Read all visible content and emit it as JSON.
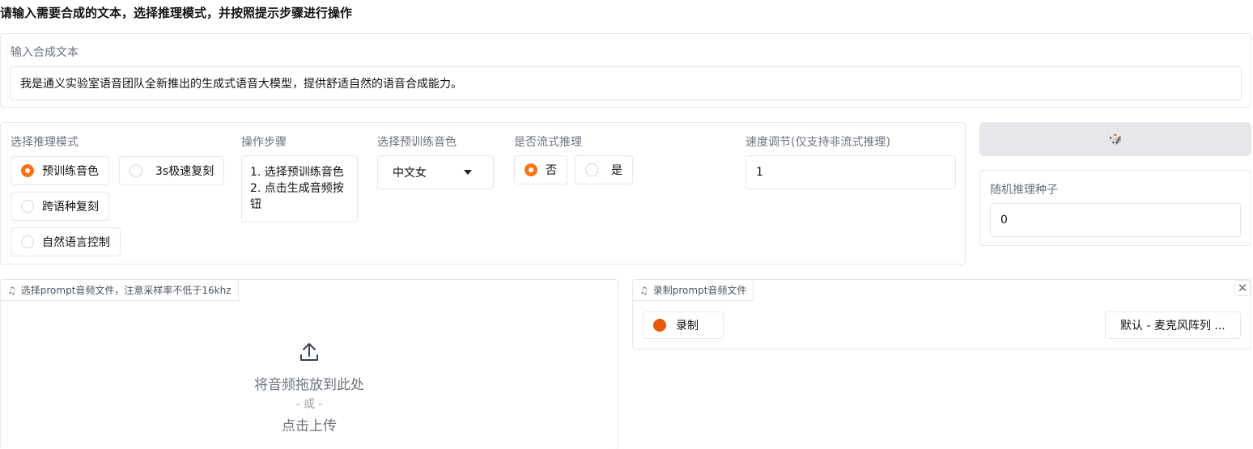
{
  "heading": "请输入需要合成的文本，选择推理模式，并按照提示步骤进行操作",
  "text_input": {
    "label": "输入合成文本",
    "value": "我是通义实验室语音团队全新推出的生成式语音大模型，提供舒适自然的语音合成能力。"
  },
  "mode": {
    "label": "选择推理模式",
    "options": [
      {
        "label": "预训练音色",
        "selected": true
      },
      {
        "label": "3s极速复刻",
        "selected": false
      },
      {
        "label": "跨语种复刻",
        "selected": false
      },
      {
        "label": "自然语言控制",
        "selected": false
      }
    ]
  },
  "steps": {
    "label": "操作步骤",
    "lines": [
      "1. 选择预训练音色",
      "2. 点击生成音频按",
      "钮"
    ]
  },
  "voice": {
    "label": "选择预训练音色",
    "value": "中文女"
  },
  "stream": {
    "label": "是否流式推理",
    "options": [
      {
        "label": "否",
        "selected": true
      },
      {
        "label": "是",
        "selected": false
      }
    ]
  },
  "speed": {
    "label": "速度调节(仅支持非流式推理)",
    "value": "1"
  },
  "seed": {
    "button_icon": "🎲",
    "label": "随机推理种子",
    "value": "0"
  },
  "upload": {
    "tag": "选择prompt音频文件，注意采样率不低于16khz",
    "drop_text": "将音频拖放到此处",
    "or_text": "- 或 -",
    "click_text": "点击上传"
  },
  "record": {
    "tag": "录制prompt音频文件",
    "button": "录制",
    "device": "默认 - 麦克风阵列 ...",
    "close": "✕"
  },
  "colors": {
    "accent": "#f97316",
    "record": "#ea580c",
    "border": "#e5e7eb"
  }
}
